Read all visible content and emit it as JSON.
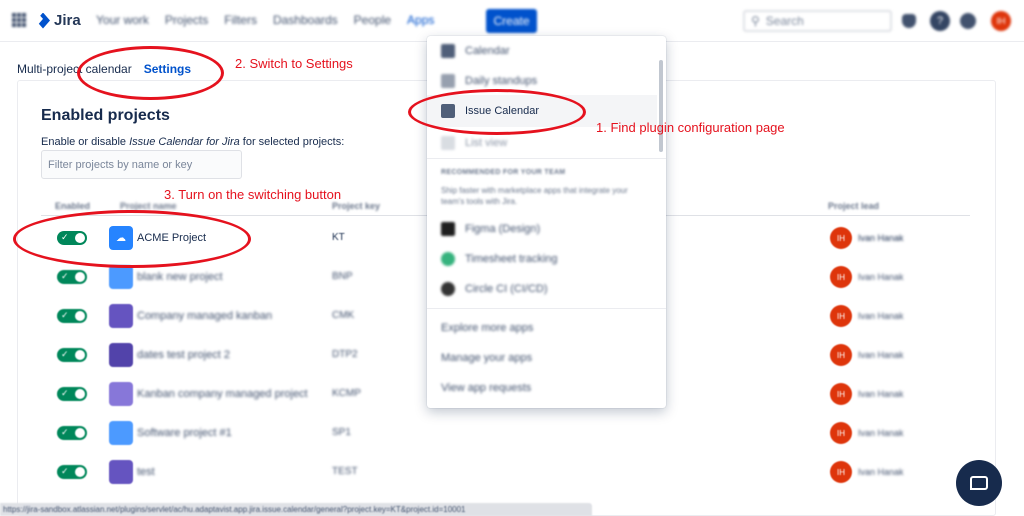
{
  "topnav": {
    "product": "Jira",
    "items": [
      "Your work",
      "Projects",
      "Filters",
      "Dashboards",
      "People",
      "Apps"
    ],
    "create_label": "Create",
    "search_placeholder": "Search",
    "user_initials": "IH"
  },
  "page": {
    "tabs": [
      "Multi-project calendar",
      "Settings"
    ],
    "section_title": "Enabled projects",
    "desc_prefix": "Enable or disable ",
    "desc_app": "Issue Calendar for Jira",
    "desc_suffix": " for selected projects:",
    "filter_placeholder": "Filter projects by name or key"
  },
  "table": {
    "headers": [
      "Enabled",
      "Project name",
      "Project key",
      "Project lead"
    ],
    "rows": [
      {
        "name": "ACME Project",
        "key": "KT",
        "lead": "Ivan Hanak",
        "lead_initials": "IH",
        "icon_color": "#2684ff"
      },
      {
        "name": "blank new project",
        "key": "BNP",
        "lead": "Ivan Hanak",
        "lead_initials": "IH",
        "icon_color": "#4c9aff"
      },
      {
        "name": "Company managed kanban",
        "key": "CMK",
        "lead": "Ivan Hanak",
        "lead_initials": "IH",
        "icon_color": "#6554c0"
      },
      {
        "name": "dates test project 2",
        "key": "DTP2",
        "lead": "Ivan Hanak",
        "lead_initials": "IH",
        "icon_color": "#5243aa"
      },
      {
        "name": "Kanban company managed project",
        "key": "KCMP",
        "lead": "Ivan Hanak",
        "lead_initials": "IH",
        "icon_color": "#8777d9"
      },
      {
        "name": "Software project #1",
        "key": "SP1",
        "lead": "Ivan Hanak",
        "lead_initials": "IH",
        "icon_color": "#4c9aff"
      },
      {
        "name": "test",
        "key": "TEST",
        "lead": "Ivan Hanak",
        "lead_initials": "IH",
        "icon_color": "#6554c0"
      }
    ]
  },
  "apps_menu": {
    "items_top": [
      "Calendar",
      "Daily standups",
      "Issue Calendar",
      "List view"
    ],
    "section_heading": "RECOMMENDED FOR YOUR TEAM",
    "section_desc": "Ship faster with marketplace apps that integrate your team's tools with Jira.",
    "recommended": [
      "Figma (Design)",
      "Timesheet tracking",
      "Circle CI (CI/CD)"
    ],
    "links": [
      "Explore more apps",
      "Manage your apps",
      "View app requests"
    ]
  },
  "status_bar": {
    "url": "https://jira-sandbox.atlassian.net/plugins/servlet/ac/hu.adaptavist.app.jira.issue.calendar/general?project.key=KT&project.id=10001"
  },
  "annotations": [
    "2. Switch to Settings",
    "1. Find plugin configuration page",
    "3. Turn on the switching button"
  ],
  "colors": {
    "brand_blue": "#0052cc",
    "toggle_on": "#00875a",
    "annotation_red": "#e5121e",
    "avatar_red": "#de350b"
  }
}
